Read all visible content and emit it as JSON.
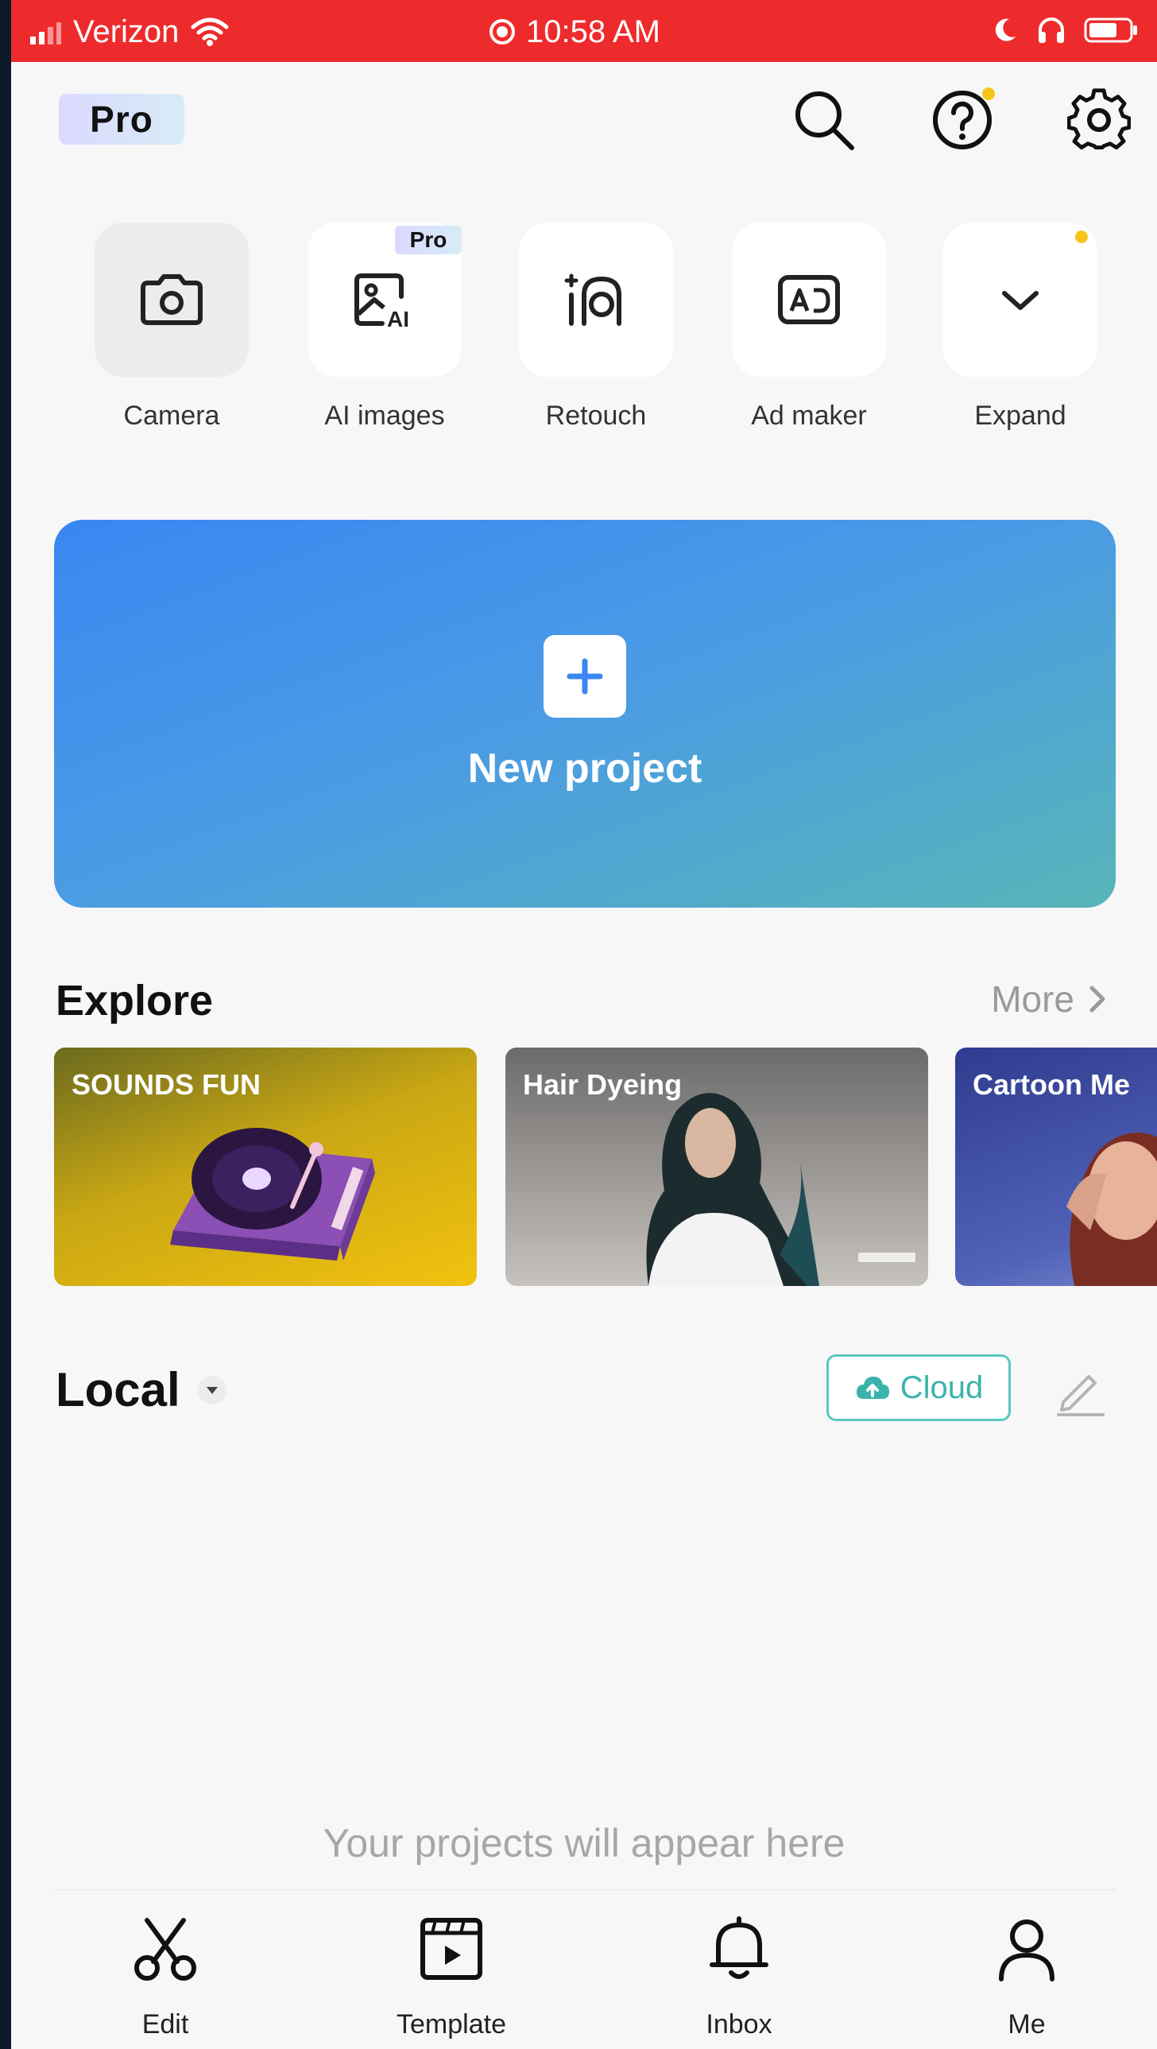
{
  "status_bar": {
    "carrier": "Verizon",
    "time": "10:58 AM"
  },
  "header": {
    "pro_label": "Pro",
    "icons": [
      "search-icon",
      "help-icon",
      "settings-icon"
    ]
  },
  "quick_tools": [
    {
      "label": "Camera",
      "icon": "camera-icon"
    },
    {
      "label": "AI images",
      "icon": "ai-image-icon",
      "badge": "Pro"
    },
    {
      "label": "Retouch",
      "icon": "retouch-icon"
    },
    {
      "label": "Ad maker",
      "icon": "ad-maker-icon"
    },
    {
      "label": "Expand",
      "icon": "chevron-down-icon"
    }
  ],
  "new_project": {
    "label": "New project"
  },
  "explore": {
    "title": "Explore",
    "more_label": "More",
    "cards": [
      {
        "label": "SOUNDS FUN"
      },
      {
        "label": "Hair Dyeing"
      },
      {
        "label": "Cartoon Me"
      }
    ]
  },
  "local": {
    "title": "Local",
    "cloud_label": "Cloud",
    "empty_text": "Your projects will appear here"
  },
  "bottom_nav": [
    {
      "label": "Edit",
      "icon": "scissors-icon"
    },
    {
      "label": "Template",
      "icon": "template-icon"
    },
    {
      "label": "Inbox",
      "icon": "bell-icon"
    },
    {
      "label": "Me",
      "icon": "person-icon"
    }
  ],
  "colors": {
    "status_bar": "#ee2b2c",
    "banner_start": "#3a86f2",
    "banner_end": "#57b5b8",
    "cloud_accent": "#3bb3ab",
    "notification_dot": "#f5c518"
  }
}
